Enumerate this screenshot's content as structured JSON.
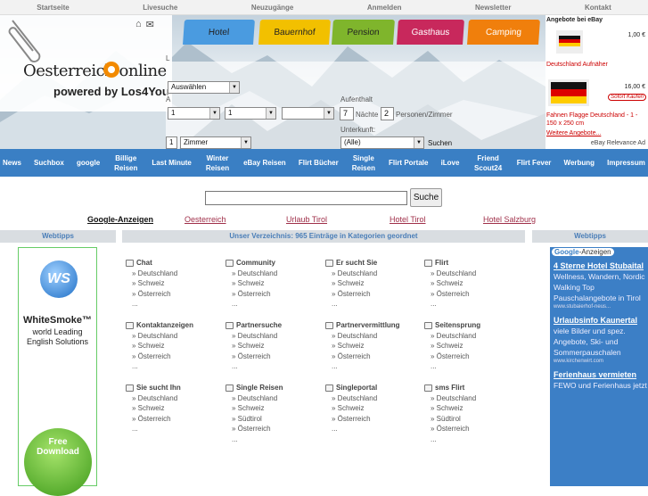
{
  "topnav": [
    "Startseite",
    "Livesuche",
    "Neuzugänge",
    "Anmelden",
    "Newsletter",
    "Kontakt"
  ],
  "tabs": [
    {
      "label": "Hotel",
      "color": "#4a9be0"
    },
    {
      "label": "Bauernhof",
      "color": "#f2c000"
    },
    {
      "label": "Pension",
      "color": "#7fb52c"
    },
    {
      "label": "Gasthaus",
      "color": "#c8285c"
    },
    {
      "label": "Camping",
      "color": "#f07f0c"
    }
  ],
  "logo": {
    "brand": "Oesterreich online",
    "powered": "powered by Los4You"
  },
  "form": {
    "select_main": "Auswählen",
    "sel1": "1",
    "sel2": "1",
    "sel3": "",
    "aufenthalt_label": "Aufenthalt",
    "naechte_value": "7",
    "naechte_label": "Nächte",
    "personen_value": "2",
    "personen_label": "Personen/Zimmer",
    "unterkunft_label": "Unterkunft:",
    "unterkunft_value": "(Alle)",
    "rooms_value": "1",
    "rooms_select": "Zimmer",
    "search_label": "Suchen",
    "label_l": "L",
    "label_a": "A"
  },
  "ebay": {
    "title": "Angebote bei eBay",
    "item1_price": "1,00 €",
    "item1_name": "Deutschland Aufnäher",
    "item2_price": "16,00 €",
    "item2_badge": "Sofort Kaufen",
    "item2_name": "Fahnen Flagge Deutschland - 1 - 150 x 250 cm",
    "more": "Weitere Angebote...",
    "footer": "eBay Relevance Ad"
  },
  "mainnav": [
    "News",
    "Suchbox",
    "google",
    "Billige Reisen",
    "Last Minute",
    "Winter Reisen",
    "eBay Reisen",
    "Flirt Bücher",
    "Single Reisen",
    "Flirt Portale",
    "iLove",
    "Friend Scout24",
    "Flirt Fever",
    "Werbung",
    "Impressum"
  ],
  "search": {
    "button": "Suche"
  },
  "gtabs": [
    "Google-Anzeigen",
    "Oesterreich",
    "Urlaub Tirol",
    "Hotel Tirol",
    "Hotel Salzburg"
  ],
  "columns": {
    "left": "Webtipps",
    "middle": "Unser Verzeichnis: 965 Einträge in Kategorien geordnet",
    "right": "Webtipps"
  },
  "leftad": {
    "brand": "WhiteSmoke™",
    "line1": "world Leading",
    "line2": "English Solutions",
    "btn": "Free Download",
    "mark": "WS"
  },
  "categories": [
    {
      "title": "Chat",
      "items": [
        "Deutschland",
        "Schweiz",
        "Österreich",
        "..."
      ]
    },
    {
      "title": "Community",
      "items": [
        "Deutschland",
        "Schweiz",
        "Österreich",
        "..."
      ]
    },
    {
      "title": "Er sucht Sie",
      "items": [
        "Deutschland",
        "Schweiz",
        "Österreich",
        "..."
      ]
    },
    {
      "title": "Flirt",
      "items": [
        "Deutschland",
        "Schweiz",
        "Österreich",
        "..."
      ]
    },
    {
      "title": "Kontaktanzeigen",
      "items": [
        "Deutschland",
        "Schweiz",
        "Österreich",
        "..."
      ]
    },
    {
      "title": "Partnersuche",
      "items": [
        "Deutschland",
        "Schweiz",
        "Österreich",
        "..."
      ]
    },
    {
      "title": "Partnervermittlung",
      "items": [
        "Deutschland",
        "Schweiz",
        "Österreich",
        "..."
      ]
    },
    {
      "title": "Seitensprung",
      "items": [
        "Deutschland",
        "Schweiz",
        "Österreich",
        "..."
      ]
    },
    {
      "title": "Sie sucht Ihn",
      "items": [
        "Deutschland",
        "Schweiz",
        "Österreich",
        "..."
      ]
    },
    {
      "title": "Single Reisen",
      "items": [
        "Deutschland",
        "Schweiz",
        "Südtirol",
        "Österreich",
        "..."
      ]
    },
    {
      "title": "Singleportal",
      "items": [
        "Deutschland",
        "Schweiz",
        "Österreich",
        "..."
      ]
    },
    {
      "title": "sms Flirt",
      "items": [
        "Deutschland",
        "Schweiz",
        "Südtirol",
        "Österreich",
        "..."
      ]
    }
  ],
  "rightad": {
    "badge_google": "Google",
    "badge_rest": "-Anzeigen",
    "ads": [
      {
        "title": "4 Sterne Hotel Stubaital",
        "text": "Wellness, Wandern, Nordic Walking Top Pauschalangebote in Tirol",
        "url": "www.stubaierhof-neus..."
      },
      {
        "title": "Urlaubsinfo Kaunertal",
        "text": "viele Bilder und spez. Angebote, Ski- und Sommerpauschalen",
        "url": "www.kirchenwirt.com"
      },
      {
        "title": "Ferienhaus vermieten",
        "text": "FEWO und Ferienhaus jetzt",
        "url": ""
      }
    ]
  }
}
